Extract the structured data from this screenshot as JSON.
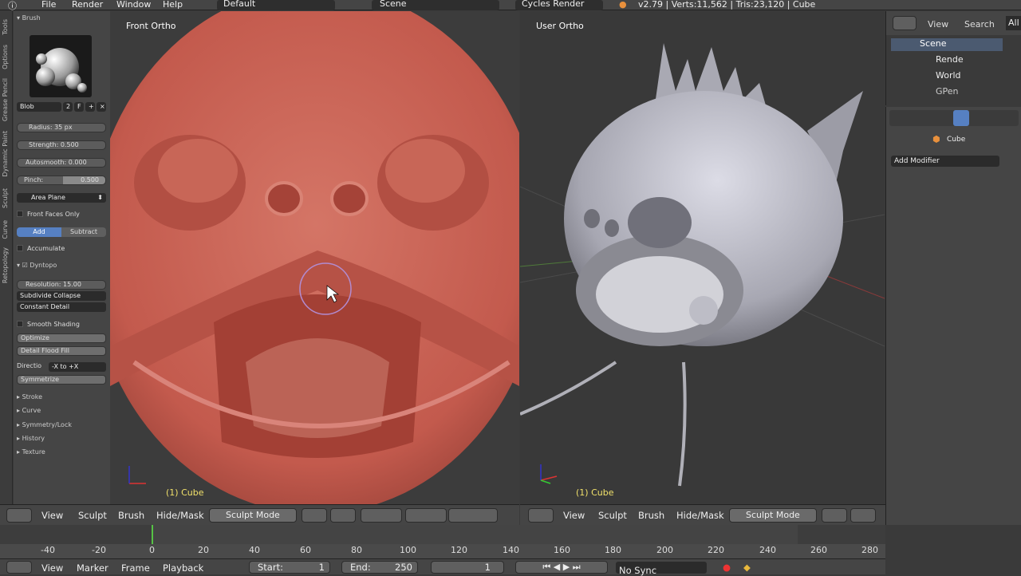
{
  "topbar": {
    "menus": [
      "File",
      "Render",
      "Window",
      "Help"
    ],
    "layout": "Default",
    "scene": "Scene",
    "engine": "Cycles Render",
    "info": "v2.79 | Verts:11,562 | Tris:23,120 | Cube"
  },
  "leftstrip": {
    "tabs": [
      "Tools",
      "Options",
      "Grease Pencil",
      "Dynamic Paint",
      "Sculpt",
      "Curve",
      "Retopology"
    ]
  },
  "tools": {
    "brush_header": "Brush",
    "brush_name": "Blob",
    "brush_users": "2",
    "brush_fake": "F",
    "radius": "Radius:   35 px",
    "strength": "Strength: 0.500",
    "autosmooth": "Autosmooth:  0.000",
    "pinch_label": "Pinch:",
    "pinch_value": "0.500",
    "plane": "Area Plane",
    "front_faces": "Front Faces Only",
    "add": "Add",
    "subtract": "Subtract",
    "accumulate": "Accumulate",
    "dyntopo": "Dyntopo",
    "resolution": "Resolution:  15.00",
    "subdivide": "Subdivide Collapse",
    "constant": "Constant Detail",
    "smooth_shading": "Smooth Shading",
    "optimize": "Optimize",
    "flood": "Detail Flood Fill",
    "direction_label": "Directio",
    "direction_value": "-X to +X",
    "symmetrize": "Symmetrize",
    "sections": [
      "Stroke",
      "Curve",
      "Symmetry/Lock",
      "History",
      "Texture"
    ]
  },
  "viewport_left": {
    "label": "Front Ortho",
    "object": "(1) Cube"
  },
  "viewport_right": {
    "label": "User Ortho",
    "object": "(1) Cube"
  },
  "header_left": {
    "items": [
      "View",
      "Sculpt",
      "Brush",
      "Hide/Mask"
    ],
    "mode": "Sculpt Mode"
  },
  "header_right": {
    "items": [
      "View",
      "Sculpt",
      "Brush",
      "Hide/Mask"
    ],
    "mode": "Sculpt Mode"
  },
  "timeline": {
    "ticks": [
      "-40",
      "-20",
      "0",
      "20",
      "40",
      "60",
      "80",
      "100",
      "120",
      "140",
      "160",
      "180",
      "200",
      "220",
      "240",
      "260",
      "280"
    ],
    "current_frame": "1"
  },
  "bottombar": {
    "items": [
      "View",
      "Marker",
      "Frame",
      "Playback"
    ],
    "start_label": "Start:",
    "start": "1",
    "end_label": "End:",
    "end": "250",
    "frame": "1",
    "sync": "No Sync"
  },
  "outliner": {
    "tabs": [
      "View",
      "Search",
      "All"
    ],
    "items": [
      "Scene",
      "Rende",
      "World",
      "GPen"
    ]
  },
  "properties": {
    "object": "Cube",
    "add_modifier": "Add Modifier"
  },
  "colors": {
    "clay": "#c35a4d",
    "mesh": "#b3b3bd",
    "accent": "#5680c2",
    "frame_marker": "#56c245"
  }
}
